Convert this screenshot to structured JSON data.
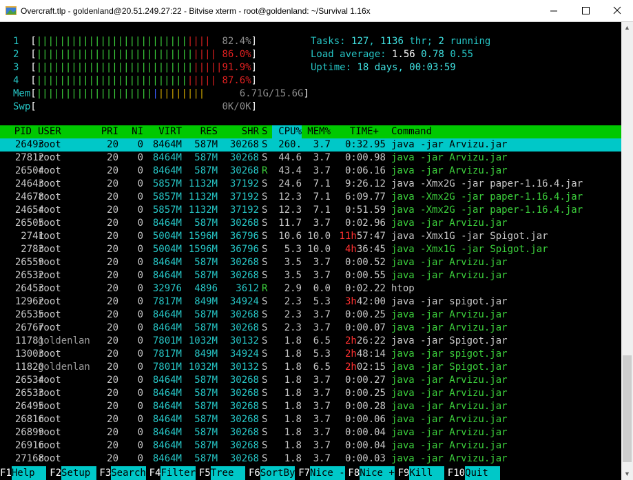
{
  "window": {
    "title": "Overcraft.tlp - goldenland@20.51.249.27:22 - Bitvise xterm - root@goldenland: ~/Survival 1.16x"
  },
  "meters": {
    "cpus": [
      {
        "label": "1",
        "value": "82.4%"
      },
      {
        "label": "2",
        "value": "86.0%"
      },
      {
        "label": "3",
        "value": "91.9%"
      },
      {
        "label": "4",
        "value": "87.6%"
      }
    ],
    "mem": {
      "label": "Mem",
      "value": "6.71G/15.6G"
    },
    "swp": {
      "label": "Swp",
      "value": "0K/0K"
    }
  },
  "summary": {
    "tasks_label": "Tasks: ",
    "tasks": "127",
    "thr": "1136",
    "thr_label": " thr; ",
    "running": "2",
    "running_label": " running",
    "load_label": "Load average: ",
    "load1": "1.56",
    "load5": "0.78",
    "load15": "0.55",
    "uptime_label": "Uptime: ",
    "uptime": "18 days, 00:03:59"
  },
  "columns": {
    "pid": "PID",
    "user": "USER",
    "pri": "PRI",
    "ni": "NI",
    "virt": "VIRT",
    "res": "RES",
    "shr": "SHR",
    "s": "S",
    "cpu": "CPU%",
    "mem": "MEM%",
    "time": "TIME+",
    "cmd": "Command"
  },
  "processes": [
    {
      "pid": "26493",
      "user": "root",
      "pri": "20",
      "ni": "0",
      "virt": "8464M",
      "res": "587M",
      "shr": "30268",
      "s": "S",
      "cpu": "260.",
      "mem": "3.7",
      "time": "0:32.95",
      "cmd": "java -jar Arvizu.jar"
    },
    {
      "pid": "27812",
      "user": "root",
      "pri": "20",
      "ni": "0",
      "virt": "8464M",
      "res": "587M",
      "shr": "30268",
      "s": "S",
      "cpu": "44.6",
      "mem": "3.7",
      "time": "0:00.98",
      "cmd": "java -jar Arvizu.jar"
    },
    {
      "pid": "26504",
      "user": "root",
      "pri": "20",
      "ni": "0",
      "virt": "8464M",
      "res": "587M",
      "shr": "30268",
      "s": "R",
      "cpu": "43.4",
      "mem": "3.7",
      "time": "0:06.16",
      "cmd": "java -jar Arvizu.jar"
    },
    {
      "pid": "24643",
      "user": "root",
      "pri": "20",
      "ni": "0",
      "virt": "5857M",
      "res": "1132M",
      "shr": "37192",
      "s": "S",
      "cpu": "24.6",
      "mem": "7.1",
      "time": "9:26.12",
      "cmd": "java -Xmx2G -jar paper-1.16.4.jar"
    },
    {
      "pid": "24678",
      "user": "root",
      "pri": "20",
      "ni": "0",
      "virt": "5857M",
      "res": "1132M",
      "shr": "37192",
      "s": "S",
      "cpu": "12.3",
      "mem": "7.1",
      "time": "6:09.77",
      "cmd": "java -Xmx2G -jar paper-1.16.4.jar"
    },
    {
      "pid": "24654",
      "user": "root",
      "pri": "20",
      "ni": "0",
      "virt": "5857M",
      "res": "1132M",
      "shr": "37192",
      "s": "S",
      "cpu": "12.3",
      "mem": "7.1",
      "time": "0:51.59",
      "cmd": "java -Xmx2G -jar paper-1.16.4.jar"
    },
    {
      "pid": "26505",
      "user": "root",
      "pri": "20",
      "ni": "0",
      "virt": "8464M",
      "res": "587M",
      "shr": "30268",
      "s": "S",
      "cpu": "11.7",
      "mem": "3.7",
      "time": "0:02.96",
      "cmd": "java -jar Arvizu.jar"
    },
    {
      "pid": "2741",
      "user": "root",
      "pri": "20",
      "ni": "0",
      "virt": "5004M",
      "res": "1596M",
      "shr": "36796",
      "s": "S",
      "cpu": "10.6",
      "mem": "10.0",
      "time_h": "11h",
      "time": "57:47",
      "cmd": "java -Xmx1G -jar Spigot.jar"
    },
    {
      "pid": "2783",
      "user": "root",
      "pri": "20",
      "ni": "0",
      "virt": "5004M",
      "res": "1596M",
      "shr": "36796",
      "s": "S",
      "cpu": "5.3",
      "mem": "10.0",
      "time_h": "4h",
      "time": "36:45",
      "cmd": "java -Xmx1G -jar Spigot.jar"
    },
    {
      "pid": "26559",
      "user": "root",
      "pri": "20",
      "ni": "0",
      "virt": "8464M",
      "res": "587M",
      "shr": "30268",
      "s": "S",
      "cpu": "3.5",
      "mem": "3.7",
      "time": "0:00.52",
      "cmd": "java -jar Arvizu.jar"
    },
    {
      "pid": "26532",
      "user": "root",
      "pri": "20",
      "ni": "0",
      "virt": "8464M",
      "res": "587M",
      "shr": "30268",
      "s": "S",
      "cpu": "3.5",
      "mem": "3.7",
      "time": "0:00.55",
      "cmd": "java -jar Arvizu.jar"
    },
    {
      "pid": "26453",
      "user": "root",
      "pri": "20",
      "ni": "0",
      "virt": "32976",
      "res": "4896",
      "shr": "3612",
      "s": "R",
      "cpu": "2.9",
      "mem": "0.0",
      "time": "0:02.22",
      "cmd": "htop"
    },
    {
      "pid": "12962",
      "user": "root",
      "pri": "20",
      "ni": "0",
      "virt": "7817M",
      "res": "849M",
      "shr": "34924",
      "s": "S",
      "cpu": "2.3",
      "mem": "5.3",
      "time_h": "3h",
      "time": "42:00",
      "cmd": "java -jar spigot.jar"
    },
    {
      "pid": "26535",
      "user": "root",
      "pri": "20",
      "ni": "0",
      "virt": "8464M",
      "res": "587M",
      "shr": "30268",
      "s": "S",
      "cpu": "2.3",
      "mem": "3.7",
      "time": "0:00.25",
      "cmd": "java -jar Arvizu.jar"
    },
    {
      "pid": "26767",
      "user": "root",
      "pri": "20",
      "ni": "0",
      "virt": "8464M",
      "res": "587M",
      "shr": "30268",
      "s": "S",
      "cpu": "2.3",
      "mem": "3.7",
      "time": "0:00.07",
      "cmd": "java -jar Arvizu.jar"
    },
    {
      "pid": "11781",
      "user": "goldenlan",
      "pri": "20",
      "ni": "0",
      "virt": "7801M",
      "res": "1032M",
      "shr": "30132",
      "s": "S",
      "cpu": "1.8",
      "mem": "6.5",
      "time_h": "2h",
      "time": "26:22",
      "cmd": "java -jar Spigot.jar"
    },
    {
      "pid": "13003",
      "user": "root",
      "pri": "20",
      "ni": "0",
      "virt": "7817M",
      "res": "849M",
      "shr": "34924",
      "s": "S",
      "cpu": "1.8",
      "mem": "5.3",
      "time_h": "2h",
      "time": "48:14",
      "cmd": "java -jar spigot.jar"
    },
    {
      "pid": "11820",
      "user": "goldenlan",
      "pri": "20",
      "ni": "0",
      "virt": "7801M",
      "res": "1032M",
      "shr": "30132",
      "s": "S",
      "cpu": "1.8",
      "mem": "6.5",
      "time_h": "2h",
      "time": "02:15",
      "cmd": "java -jar Spigot.jar"
    },
    {
      "pid": "26534",
      "user": "root",
      "pri": "20",
      "ni": "0",
      "virt": "8464M",
      "res": "587M",
      "shr": "30268",
      "s": "S",
      "cpu": "1.8",
      "mem": "3.7",
      "time": "0:00.27",
      "cmd": "java -jar Arvizu.jar"
    },
    {
      "pid": "26533",
      "user": "root",
      "pri": "20",
      "ni": "0",
      "virt": "8464M",
      "res": "587M",
      "shr": "30268",
      "s": "S",
      "cpu": "1.8",
      "mem": "3.7",
      "time": "0:00.25",
      "cmd": "java -jar Arvizu.jar"
    },
    {
      "pid": "26495",
      "user": "root",
      "pri": "20",
      "ni": "0",
      "virt": "8464M",
      "res": "587M",
      "shr": "30268",
      "s": "S",
      "cpu": "1.8",
      "mem": "3.7",
      "time": "0:00.28",
      "cmd": "java -jar Arvizu.jar"
    },
    {
      "pid": "26816",
      "user": "root",
      "pri": "20",
      "ni": "0",
      "virt": "8464M",
      "res": "587M",
      "shr": "30268",
      "s": "S",
      "cpu": "1.8",
      "mem": "3.7",
      "time": "0:00.06",
      "cmd": "java -jar Arvizu.jar"
    },
    {
      "pid": "26899",
      "user": "root",
      "pri": "20",
      "ni": "0",
      "virt": "8464M",
      "res": "587M",
      "shr": "30268",
      "s": "S",
      "cpu": "1.8",
      "mem": "3.7",
      "time": "0:00.04",
      "cmd": "java -jar Arvizu.jar"
    },
    {
      "pid": "26916",
      "user": "root",
      "pri": "20",
      "ni": "0",
      "virt": "8464M",
      "res": "587M",
      "shr": "30268",
      "s": "S",
      "cpu": "1.8",
      "mem": "3.7",
      "time": "0:00.04",
      "cmd": "java -jar Arvizu.jar"
    },
    {
      "pid": "27168",
      "user": "root",
      "pri": "20",
      "ni": "0",
      "virt": "8464M",
      "res": "587M",
      "shr": "30268",
      "s": "S",
      "cpu": "1.8",
      "mem": "3.7",
      "time": "0:00.03",
      "cmd": "java -jar Arvizu.jar"
    }
  ],
  "fkeys": [
    {
      "num": "F1",
      "label": "Help  "
    },
    {
      "num": "F2",
      "label": "Setup "
    },
    {
      "num": "F3",
      "label": "Search"
    },
    {
      "num": "F4",
      "label": "Filter"
    },
    {
      "num": "F5",
      "label": "Tree  "
    },
    {
      "num": "F6",
      "label": "SortBy"
    },
    {
      "num": "F7",
      "label": "Nice -"
    },
    {
      "num": "F8",
      "label": "Nice +"
    },
    {
      "num": "F9",
      "label": "Kill  "
    },
    {
      "num": "F10",
      "label": "Quit  "
    }
  ],
  "colors": {
    "header_bar": "#00c800",
    "selected_row": "#00c8c8",
    "fkey_label": "#00c8c8"
  }
}
